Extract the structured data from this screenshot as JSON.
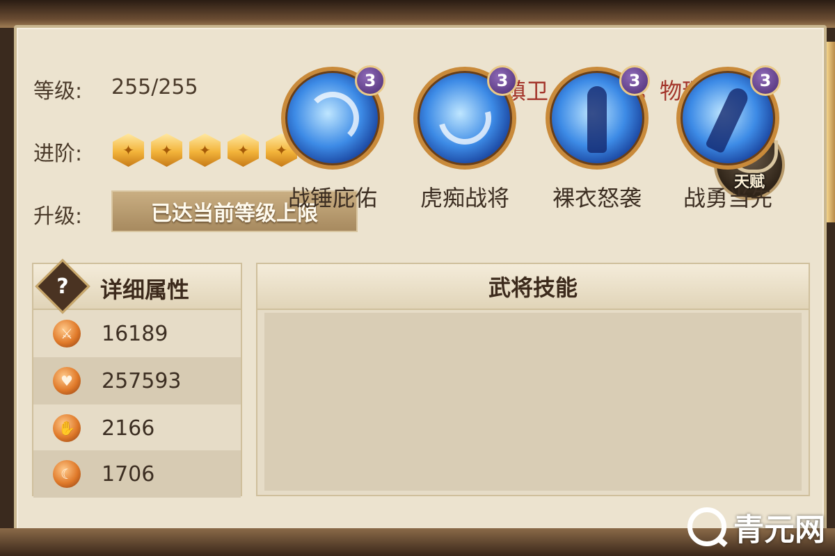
{
  "info": {
    "level_label": "等级:",
    "level_value": "255/255",
    "class_text": "镇卫（高防御，物理型）",
    "advance_label": "进阶:",
    "advance_stars": 6,
    "upgrade_label": "升级:",
    "upgrade_status": "已达当前等级上限",
    "talent_label": "天赋"
  },
  "attributes": {
    "title": "详细属性",
    "help_symbol": "?",
    "rows": [
      {
        "icon": "attack-icon",
        "value": "16189"
      },
      {
        "icon": "heart-icon",
        "value": "257593"
      },
      {
        "icon": "defense-icon",
        "value": "2166"
      },
      {
        "icon": "speed-icon",
        "value": "1706"
      }
    ]
  },
  "skills": {
    "title": "武将技能",
    "items": [
      {
        "name": "战锤庇佑",
        "level": "3",
        "icon": "vortex-icon"
      },
      {
        "name": "虎痴战将",
        "level": "3",
        "icon": "wind-slash-icon"
      },
      {
        "name": "裸衣怒袭",
        "level": "3",
        "icon": "warrior-figure-icon"
      },
      {
        "name": "战勇当先",
        "level": "3",
        "icon": "charging-warrior-icon"
      }
    ]
  },
  "watermark": {
    "text": "青元网"
  },
  "colors": {
    "panel_bg": "#ece3cf",
    "class_text": "#a3342a",
    "skill_badge": "#4b2c73",
    "star_gold": "#f3b43a"
  }
}
